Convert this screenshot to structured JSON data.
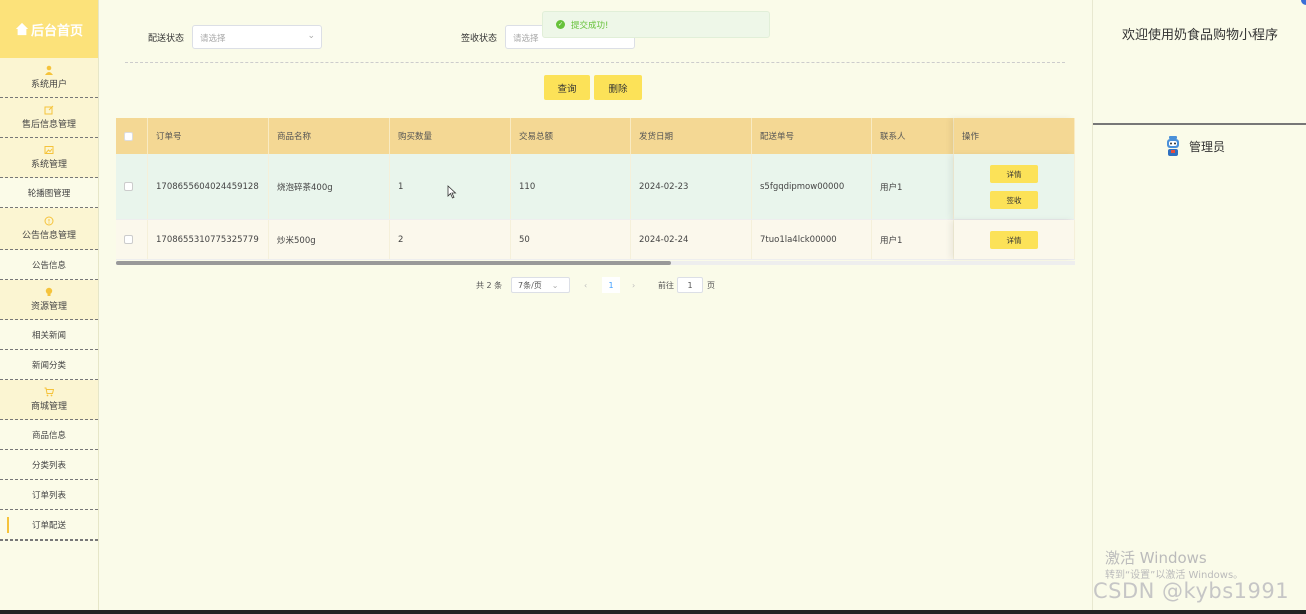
{
  "sidebar": {
    "logo": "后台首页",
    "items": [
      {
        "label": "系统用户",
        "icon": "user-icon",
        "type": "group"
      },
      {
        "label": "售后信息管理",
        "icon": "edit-icon",
        "type": "group"
      },
      {
        "label": "系统管理",
        "icon": "image-icon",
        "type": "group"
      },
      {
        "label": "轮播图管理",
        "type": "sub"
      },
      {
        "label": "公告信息管理",
        "icon": "info-icon",
        "type": "group"
      },
      {
        "label": "公告信息",
        "type": "sub"
      },
      {
        "label": "资源管理",
        "icon": "bulb-icon",
        "type": "group"
      },
      {
        "label": "相关新闻",
        "type": "sub"
      },
      {
        "label": "新闻分类",
        "type": "sub"
      },
      {
        "label": "商城管理",
        "icon": "cart-icon",
        "type": "group"
      },
      {
        "label": "商品信息",
        "type": "sub"
      },
      {
        "label": "分类列表",
        "type": "sub"
      },
      {
        "label": "订单列表",
        "type": "sub"
      },
      {
        "label": "订单配送",
        "type": "sub",
        "active": true
      }
    ]
  },
  "filters": {
    "delivery_label": "配送状态",
    "delivery_placeholder": "请选择",
    "receipt_label": "签收状态",
    "receipt_placeholder": "请选择"
  },
  "toolbar": {
    "query": "查询",
    "delete": "删除"
  },
  "toast": {
    "message": "提交成功!"
  },
  "table": {
    "headers": [
      "订单号",
      "商品名称",
      "购买数量",
      "交易总额",
      "发货日期",
      "配送单号",
      "联系人",
      "操作"
    ],
    "rows": [
      {
        "order_no": "1708655604024459128",
        "product": "烧泡碎茶400g",
        "qty": "1",
        "total": "110",
        "date": "2024-02-23",
        "tracking": "s5fgqdipmow00000",
        "contact": "用户1",
        "actions": [
          "详情",
          "签收"
        ]
      },
      {
        "order_no": "1708655310775325779",
        "product": "炒米500g",
        "qty": "2",
        "total": "50",
        "date": "2024-02-24",
        "tracking": "7tuo1la4lck00000",
        "contact": "用户1",
        "actions": [
          "详情"
        ]
      }
    ]
  },
  "pagination": {
    "total": "共 2 条",
    "page_size": "7条/页",
    "current": "1",
    "goto_label": "前往",
    "goto_value": "1",
    "page_unit": "页"
  },
  "right": {
    "welcome": "欢迎使用奶食品购物小程序",
    "user": "管理员"
  },
  "overlay": {
    "activate_title": "激活 Windows",
    "activate_sub": "转到“设置”以激活 Windows。",
    "csdn": "CSDN @kybs1991"
  },
  "colors": {
    "accent": "#fce258",
    "header": "#f4d894",
    "success": "#67c23a"
  }
}
